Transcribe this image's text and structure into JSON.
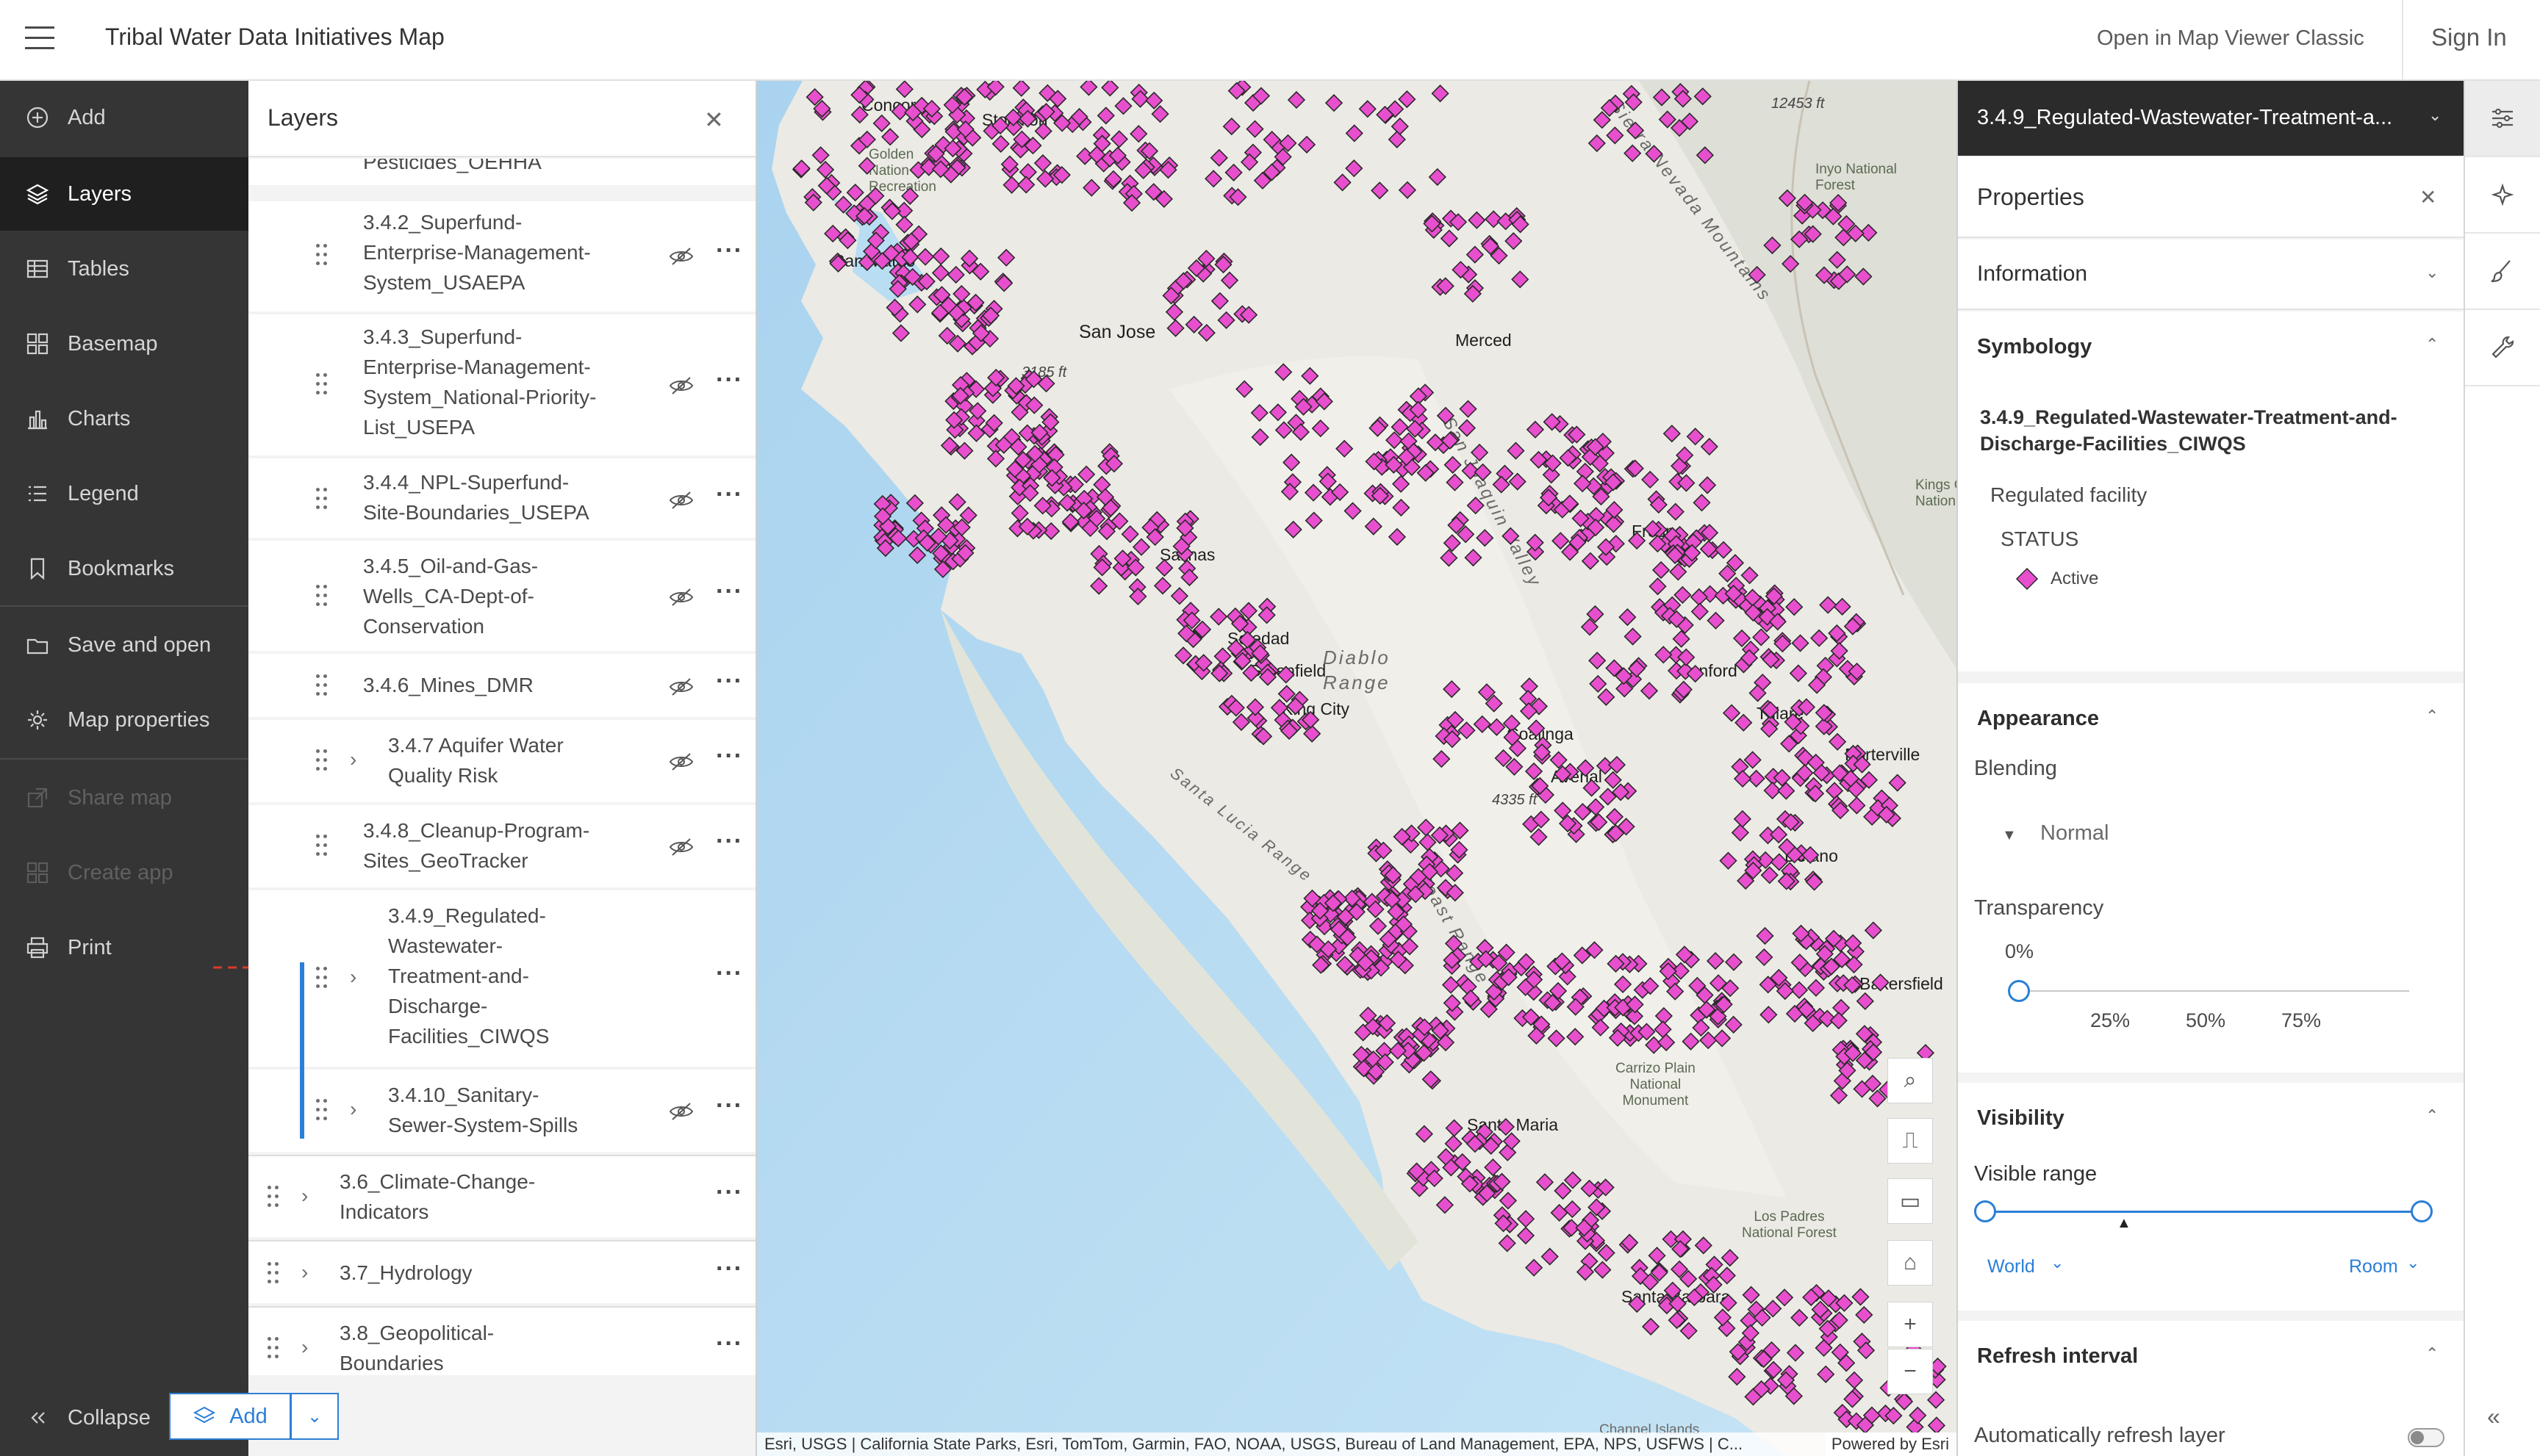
{
  "header": {
    "title": "Tribal Water Data Initiatives Map",
    "open_classic": "Open in Map Viewer Classic",
    "sign_in": "Sign In"
  },
  "nav": {
    "items": [
      {
        "label": "Add",
        "icon": "plus-circle-icon"
      },
      {
        "label": "Layers",
        "icon": "layers-icon"
      },
      {
        "label": "Tables",
        "icon": "table-icon"
      },
      {
        "label": "Basemap",
        "icon": "basemap-icon"
      },
      {
        "label": "Charts",
        "icon": "chart-icon"
      },
      {
        "label": "Legend",
        "icon": "legend-icon"
      },
      {
        "label": "Bookmarks",
        "icon": "bookmark-icon"
      },
      {
        "label": "Save and open",
        "icon": "save-icon"
      },
      {
        "label": "Map properties",
        "icon": "gear-icon"
      },
      {
        "label": "Share map",
        "icon": "share-icon"
      },
      {
        "label": "Create app",
        "icon": "create-app-icon"
      },
      {
        "label": "Print",
        "icon": "print-icon"
      }
    ],
    "collapse": "Collapse"
  },
  "layers": {
    "title": "Layers",
    "rows": [
      {
        "text": "Pesticides_OEHHA"
      },
      {
        "text": "3.4.2_Superfund-\nEnterprise-Management-\nSystem_USAEPA"
      },
      {
        "text": "3.4.3_Superfund-\nEnterprise-Management-\nSystem_National-Priority-\nList_USEPA"
      },
      {
        "text": "3.4.4_NPL-Superfund-\nSite-Boundaries_USEPA"
      },
      {
        "text": "3.4.5_Oil-and-Gas-\nWells_CA-Dept-of-\nConservation"
      },
      {
        "text": "3.4.6_Mines_DMR"
      },
      {
        "text": "3.4.7 Aquifer Water\nQuality Risk"
      },
      {
        "text": "3.4.8_Cleanup-Program-\nSites_GeoTracker"
      },
      {
        "text": "3.4.9_Regulated-\nWastewater-\nTreatment-and-\nDischarge-\nFacilities_CIWQS"
      },
      {
        "text": "3.4.10_Sanitary-\nSewer-System-Spills"
      },
      {
        "text": "3.6_Climate-Change-\nIndicators"
      },
      {
        "text": "3.7_Hydrology"
      },
      {
        "text": "3.8_Geopolitical-\nBoundaries"
      }
    ],
    "add_label": "Add"
  },
  "map": {
    "labels": {
      "concord": "Concord",
      "san_mateo": "San Mateo",
      "san_jose": "San Jose",
      "merced": "Merced",
      "salinas": "Salinas",
      "soledad": "Soledad",
      "greenfield": "Greenfield",
      "king_city": "King City",
      "hanford": "Hanford",
      "tulare": "Tulare",
      "coalinga": "Coalinga",
      "avenal": "Avenal",
      "porterville": "Porterville",
      "delano": "Delano",
      "bakersfield": "Bakersfield",
      "santa_maria": "Santa Maria",
      "santa_barbara": "Santa Barbara",
      "fresno": "Fresno",
      "stockton": "Stockton",
      "diablo": "Diablo\nRange",
      "san_joaquin": "San Joaquin Valley",
      "santa_lucia": "Santa Lucia Range",
      "coast_range": "Coast Range",
      "sierra": "Sierra Nevada Mountains",
      "elev_12453": "12453 ft",
      "elev_4335": "4335 ft",
      "elev_3185": "3185 ft",
      "inyo": "Inyo National\nForest",
      "golden": "Golden\nNation\nRecreation",
      "carrizo": "Carrizo Plain\nNational\nMonument",
      "los_padres": "Los Padres\nNational Forest",
      "kings": "Kings C\nNation",
      "channel": "Channel Islands"
    },
    "attribution": "Esri, USGS | California State Parks, Esri, TomTom, Garmin, FAO, NOAA, USGS, Bureau of Land Management, EPA, NPS, USFWS | C...",
    "powered_by": "Powered by Esri",
    "marker_color": "#e84fce"
  },
  "props": {
    "layer_name": "3.4.9_Regulated-Wastewater-Treatment-a...",
    "title": "Properties",
    "information": "Information",
    "symbology": "Symbology",
    "sym_layer": "3.4.9_Regulated-Wastewater-Treatment-and-\nDischarge-Facilities_CIWQS",
    "regulated": "Regulated facility",
    "status": "STATUS",
    "active": "Active",
    "appearance": "Appearance",
    "blending": "Blending",
    "blending_value": "Normal",
    "transparency": "Transparency",
    "transparency_value": "0%",
    "ticks": [
      "25%",
      "50%",
      "75%"
    ],
    "visibility": "Visibility",
    "visible_range": "Visible range",
    "range_min": "World",
    "range_max": "Room",
    "refresh": "Refresh interval",
    "auto_refresh": "Automatically refresh layer"
  }
}
